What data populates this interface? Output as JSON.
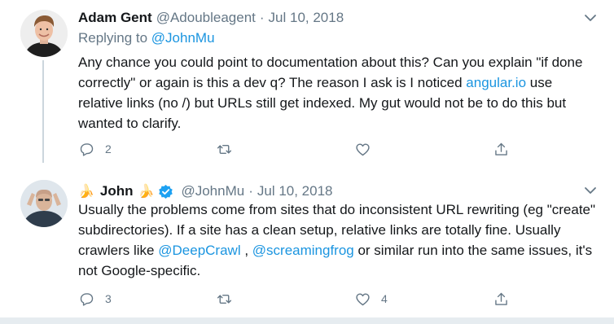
{
  "tweets": [
    {
      "name": "Adam Gent",
      "handle": "@Adoubleagent",
      "separator": "·",
      "date": "Jul 10, 2018",
      "replying_prefix": "Replying to",
      "replying_to": "@JohnMu",
      "body_parts": [
        "Any chance you could point to documentation about this? Can you explain \"if done correctly\" or again is this a dev q? The reason I ask is I noticed ",
        "angular.io",
        " use relative links (no /) but URLs still get indexed. My gut would not be to do this but wanted to clarify."
      ],
      "actions": {
        "reply_count": "2",
        "retweet_count": "",
        "like_count": ""
      }
    },
    {
      "emoji_left": "🍌",
      "name": "John",
      "emoji_right": "🍌",
      "verified": true,
      "handle": "@JohnMu",
      "separator": "·",
      "date": "Jul 10, 2018",
      "body_parts": [
        "Usually the problems come from sites that do inconsistent URL rewriting (eg \"create\" subdirectories). If a site has a clean setup, relative links are totally fine. Usually crawlers like ",
        "@DeepCrawl",
        " , ",
        "@screamingfrog",
        " or similar run into the same issues, it's not Google-specific."
      ],
      "actions": {
        "reply_count": "3",
        "retweet_count": "",
        "like_count": "4"
      }
    }
  ],
  "colors": {
    "link": "#1b95e0",
    "secondary_text": "#657786",
    "verified": "#1da1f2",
    "thread_line": "#ccd6dd"
  },
  "icons": [
    "reply-icon",
    "retweet-icon",
    "like-icon",
    "share-icon",
    "caret-down-icon",
    "verified-badge-icon"
  ]
}
